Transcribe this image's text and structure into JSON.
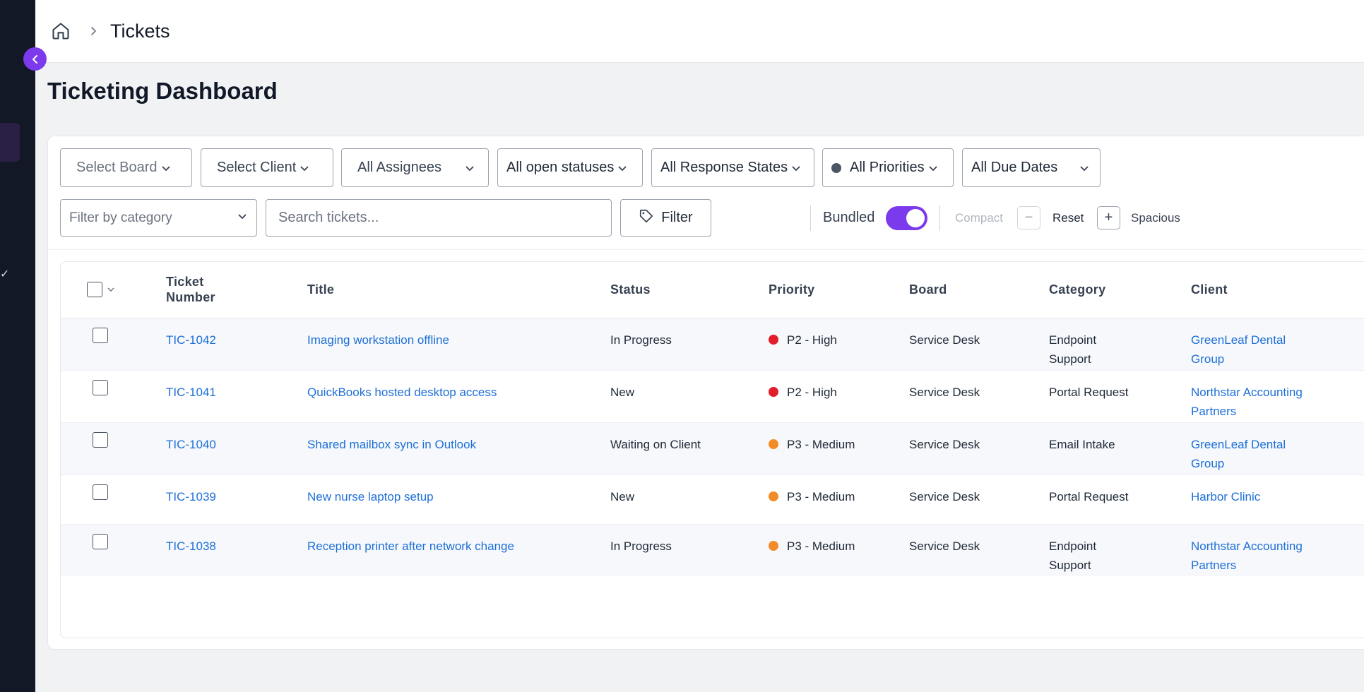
{
  "breadcrumb": {
    "current": "Tickets"
  },
  "page": {
    "title": "Ticketing Dashboard"
  },
  "filters": {
    "board": "Select Board",
    "client": "Select Client",
    "assignees": "All Assignees",
    "statuses": "All open statuses",
    "response_states": "All Response States",
    "priorities": "All Priorities",
    "due_dates": "All Due Dates",
    "category_placeholder": "Filter by category",
    "search_placeholder": "Search tickets...",
    "filter_button": "Filter",
    "bundled_label": "Bundled",
    "bundled_on": true,
    "compact_label": "Compact",
    "reset_label": "Reset",
    "spacious_label": "Spacious"
  },
  "table": {
    "columns": {
      "ticket_number": "Ticket Number",
      "title": "Title",
      "status": "Status",
      "priority": "Priority",
      "board": "Board",
      "category": "Category",
      "client": "Client"
    },
    "rows": [
      {
        "number": "TIC-1042",
        "title": "Imaging workstation offline",
        "status": "In Progress",
        "priority": "P2 - High",
        "priority_color": "#e11d2a",
        "board": "Service Desk",
        "category": "Endpoint Support",
        "client": "GreenLeaf Dental Group"
      },
      {
        "number": "TIC-1041",
        "title": "QuickBooks hosted desktop access",
        "status": "New",
        "priority": "P2 - High",
        "priority_color": "#e11d2a",
        "board": "Service Desk",
        "category": "Portal Request",
        "client": "Northstar Accounting Partners"
      },
      {
        "number": "TIC-1040",
        "title": "Shared mailbox sync in Outlook",
        "status": "Waiting on Client",
        "priority": "P3 - Medium",
        "priority_color": "#f28c28",
        "board": "Service Desk",
        "category": "Email Intake",
        "client": "GreenLeaf Dental Group"
      },
      {
        "number": "TIC-1039",
        "title": "New nurse laptop setup",
        "status": "New",
        "priority": "P3 - Medium",
        "priority_color": "#f28c28",
        "board": "Service Desk",
        "category": "Portal Request",
        "client": "Harbor Clinic"
      },
      {
        "number": "TIC-1038",
        "title": "Reception printer after network change",
        "status": "In Progress",
        "priority": "P3 - Medium",
        "priority_color": "#f28c28",
        "board": "Service Desk",
        "category": "Endpoint Support",
        "client": "Northstar Accounting Partners"
      }
    ]
  },
  "colors": {
    "accent": "#7c3aed",
    "sidebar": "#121826",
    "link": "#1d6fd8"
  }
}
